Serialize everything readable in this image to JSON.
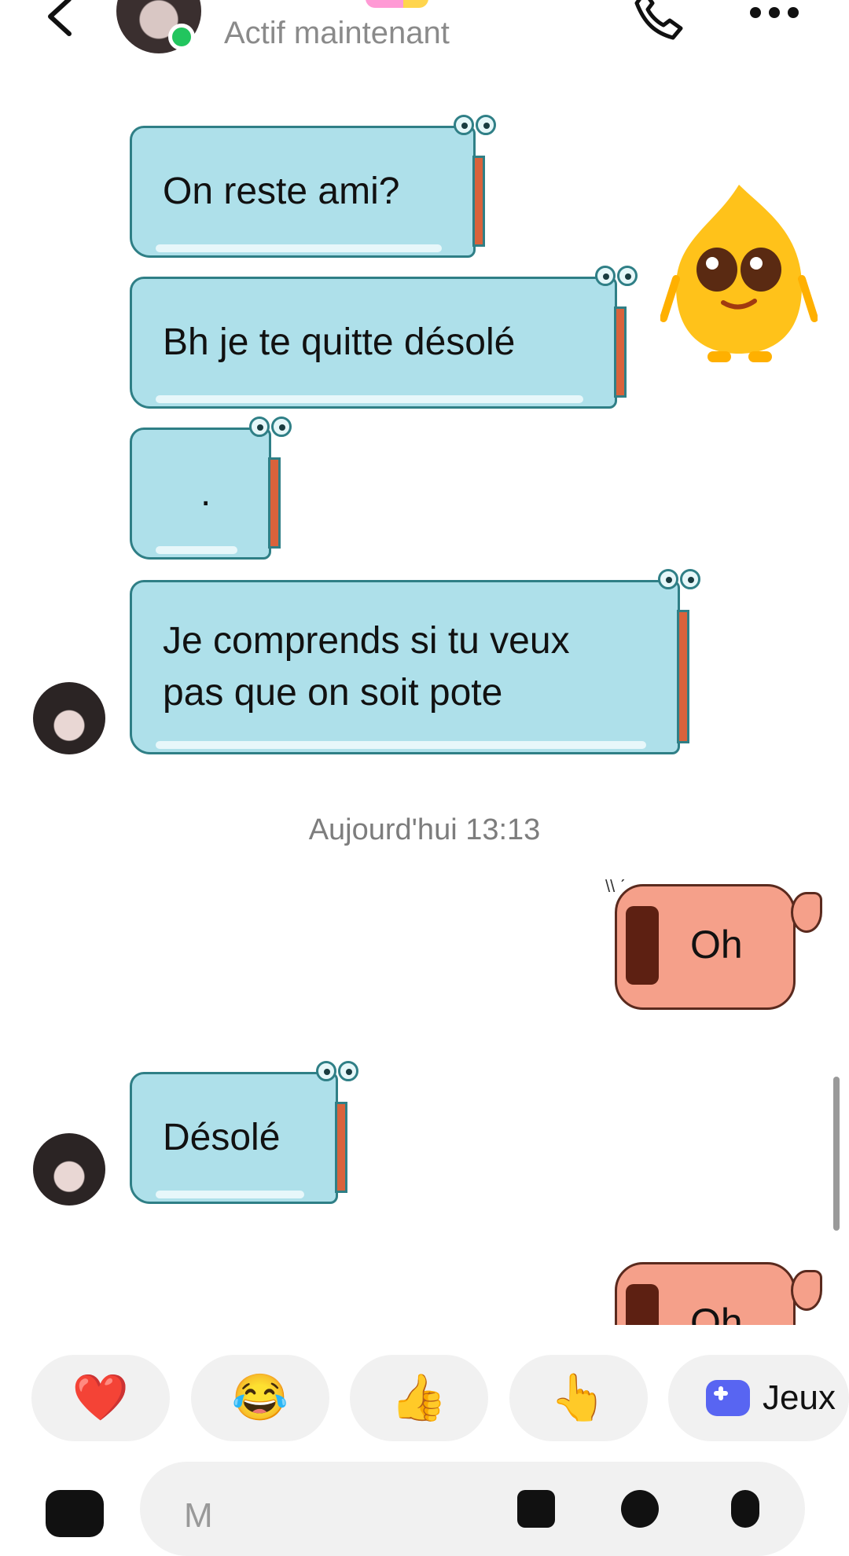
{
  "header": {
    "status": "Actif maintenant"
  },
  "messages": [
    {
      "type": "received",
      "text": "On reste ami?"
    },
    {
      "type": "received",
      "text": "Bh je te quitte désolé"
    },
    {
      "type": "received",
      "text": "."
    },
    {
      "type": "received",
      "text": "Je comprends si tu veux\npas que on soit pote"
    },
    {
      "type": "timestamp",
      "text": "Aujourd'hui 13:13"
    },
    {
      "type": "sent",
      "text": "Oh"
    },
    {
      "type": "received",
      "text": "Désolé"
    },
    {
      "type": "sent",
      "text": "Oh"
    }
  ],
  "quick_reactions": [
    "❤️",
    "😂",
    "👍",
    "👆",
    "Jeux"
  ],
  "composer": {
    "placeholder": "M"
  },
  "colors": {
    "online": "#22c55e",
    "bubble_received": "#aee0ea",
    "bubble_sent": "#f5a08a"
  }
}
